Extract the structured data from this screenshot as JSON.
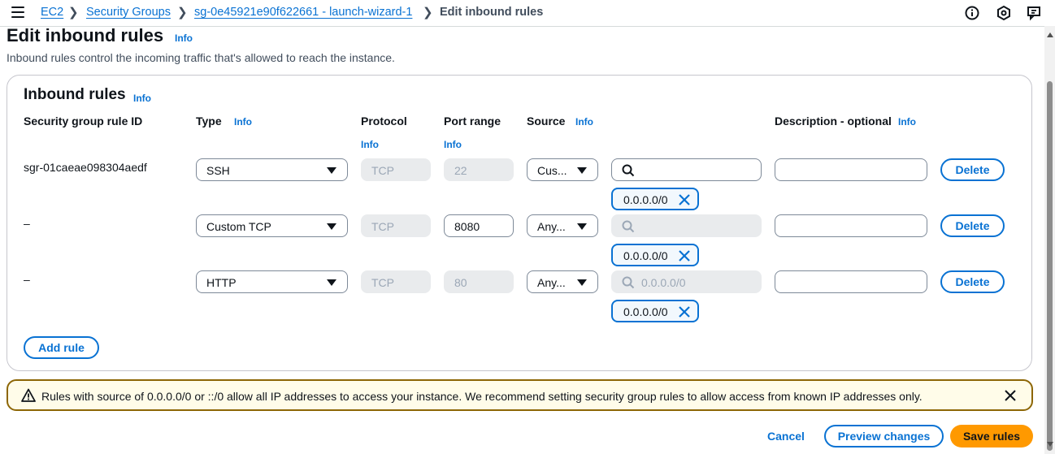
{
  "breadcrumb": {
    "items": [
      "EC2",
      "Security Groups",
      "sg-0e45921e90f622661 - launch-wizard-1"
    ],
    "current": "Edit inbound rules"
  },
  "page": {
    "title": "Edit inbound rules",
    "title_info": "Info",
    "description": "Inbound rules control the incoming traffic that's allowed to reach the instance."
  },
  "panel": {
    "title": "Inbound rules",
    "title_info": "Info",
    "columns": {
      "rule_id": "Security group rule ID",
      "type": "Type",
      "type_info": "Info",
      "protocol": "Protocol",
      "protocol_info": "Info",
      "port_range": "Port range",
      "port_info": "Info",
      "source": "Source",
      "source_info": "Info",
      "description": "Description - optional",
      "description_info": "Info"
    },
    "rules": [
      {
        "id": "sgr-01caeae098304aedf",
        "type": "SSH",
        "protocol": "TCP",
        "port": "22",
        "source": "Cus...",
        "search_placeholder": "",
        "token": "0.0.0.0/0",
        "description": "",
        "delete": "Delete"
      },
      {
        "id": "–",
        "type": "Custom TCP",
        "protocol": "TCP",
        "port": "8080",
        "source": "Any...",
        "search_placeholder": "",
        "token": "0.0.0.0/0",
        "description": "",
        "delete": "Delete"
      },
      {
        "id": "–",
        "type": "HTTP",
        "protocol": "TCP",
        "port": "80",
        "source": "Any...",
        "search_placeholder": "0.0.0.0/0",
        "token": "0.0.0.0/0",
        "description": "",
        "delete": "Delete"
      }
    ],
    "add_rule": "Add rule"
  },
  "alert": {
    "text": "Rules with source of 0.0.0.0/0 or ::/0 allow all IP addresses to access your instance. We recommend setting security group rules to allow access from known IP addresses only."
  },
  "footer": {
    "cancel": "Cancel",
    "preview": "Preview changes",
    "save": "Save rules"
  },
  "colors": {
    "link": "#0972d3",
    "primary_button": "#ff9900",
    "warning_border": "#8d6605",
    "warning_bg": "#fffce9"
  },
  "icons": [
    "menu-icon",
    "chevron-right-icon",
    "info-circle-icon",
    "settings-hexagon-icon",
    "notification-icon",
    "caret-down-icon",
    "search-icon",
    "close-icon",
    "warning-icon"
  ]
}
